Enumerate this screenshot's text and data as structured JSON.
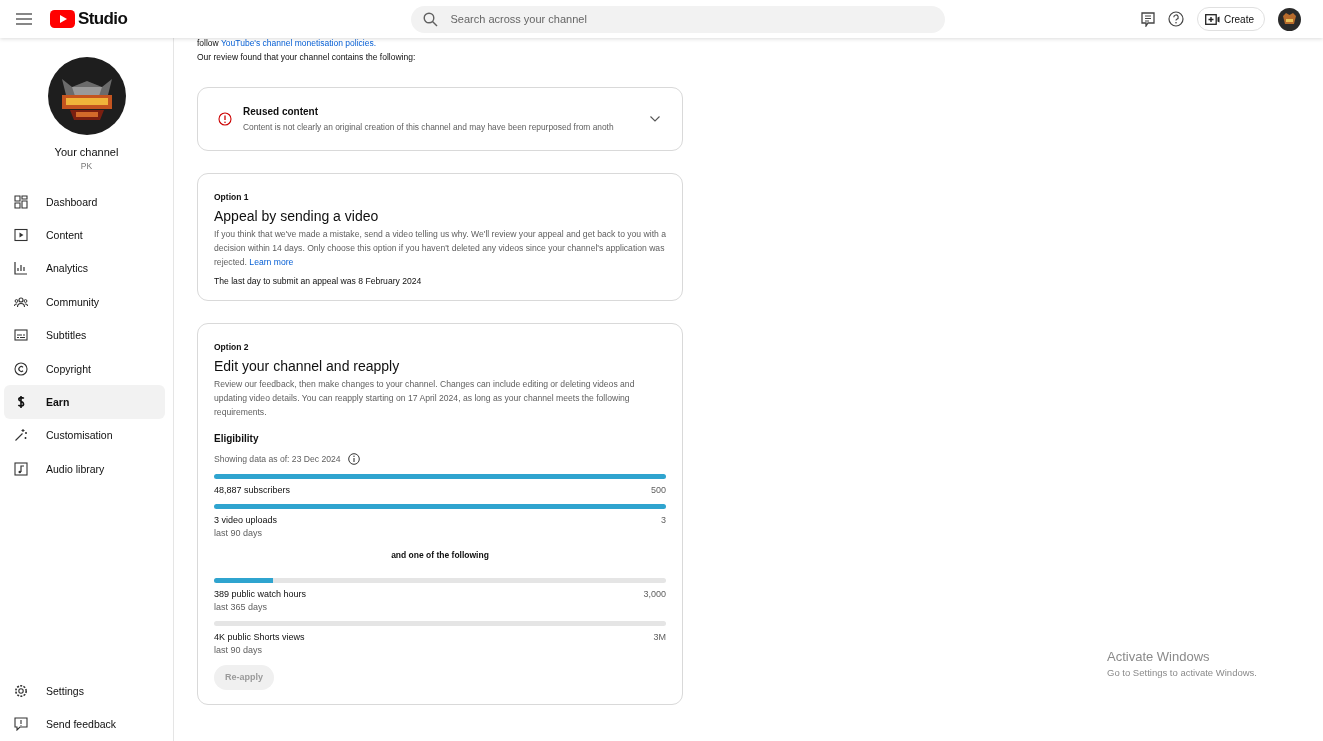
{
  "header": {
    "logo_text": "Studio",
    "search": {
      "placeholder": "Search across your channel"
    },
    "create_button": "Create"
  },
  "sidebar": {
    "channel_title": "Your channel",
    "channel_name": "PK",
    "items": [
      {
        "label": "Dashboard",
        "selected": false
      },
      {
        "label": "Content",
        "selected": false
      },
      {
        "label": "Analytics",
        "selected": false
      },
      {
        "label": "Community",
        "selected": false
      },
      {
        "label": "Subtitles",
        "selected": false
      },
      {
        "label": "Copyright",
        "selected": false
      },
      {
        "label": "Earn",
        "selected": true
      },
      {
        "label": "Customisation",
        "selected": false
      },
      {
        "label": "Audio library",
        "selected": false
      }
    ],
    "footer_items": [
      {
        "label": "Settings"
      },
      {
        "label": "Send feedback"
      }
    ]
  },
  "intro": {
    "prefix": "follow",
    "link": "YouTube's channel monetisation policies.",
    "review_text": "Our review found that your channel contains the following:"
  },
  "finding": {
    "title": "Reused content",
    "description": "Content is not clearly an original creation of this channel and may have been repurposed from anoth",
    "expanded": false
  },
  "option1": {
    "label": "Option 1",
    "title": "Appeal by sending a video",
    "body": "If you think that we've made a mistake, send a video telling us why. We'll review your appeal and get back to you with a decision within 14 days. Only choose this option if you haven't deleted any videos since your channel's application was rejected.",
    "link": "Learn more",
    "deadline": "The last day to submit an appeal was 8 February 2024"
  },
  "option2": {
    "label": "Option 2",
    "title": "Edit your channel and reapply",
    "body": "Review our feedback, then make changes to your channel. Changes can include editing or deleting videos and updating video details. You can reapply starting on 17 April 2024, as long as your channel meets the following requirements.",
    "eligibility_title": "Eligibility",
    "data_as_of": "Showing data as of: 23 Dec 2024",
    "required": [
      {
        "label": "48,887 subscribers",
        "target": "500",
        "level": 1
      },
      {
        "label": "3 video uploads",
        "sublabel": "last 90 days",
        "target": "3",
        "level": 1
      }
    ],
    "alternative_heading": "and one of the following",
    "alternatives": [
      {
        "label": "389 public watch hours",
        "sublabel": "last 365 days",
        "target": "3,000",
        "level": 0.13
      },
      {
        "label": "4K public Shorts views",
        "sublabel": "last 90 days",
        "target": "3M",
        "level": 0
      }
    ],
    "reapply_button": {
      "label": "Re-apply",
      "disabled": true
    }
  },
  "os_watermark": {
    "title": "Activate Windows",
    "subtitle": "Go to Settings to activate Windows."
  }
}
